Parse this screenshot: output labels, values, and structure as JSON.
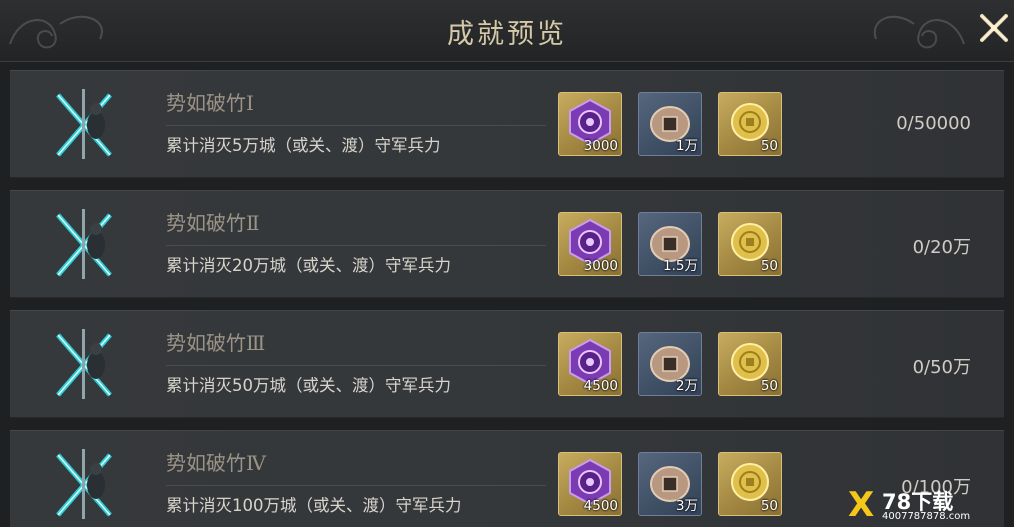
{
  "header": {
    "title": "成就预览"
  },
  "rows": [
    {
      "name": "势如破竹Ⅰ",
      "desc": "累计消灭5万城（或关、渡）守军兵力",
      "progress": "0/50000",
      "rewards": [
        {
          "icon": "purple-token-icon",
          "qty": "3000"
        },
        {
          "icon": "copper-coin-pouch-icon",
          "qty": "1万"
        },
        {
          "icon": "gold-coin-icon",
          "qty": "50"
        }
      ]
    },
    {
      "name": "势如破竹Ⅱ",
      "desc": "累计消灭20万城（或关、渡）守军兵力",
      "progress": "0/20万",
      "rewards": [
        {
          "icon": "purple-token-icon",
          "qty": "3000"
        },
        {
          "icon": "copper-coin-pouch-icon",
          "qty": "1.5万"
        },
        {
          "icon": "gold-coin-icon",
          "qty": "50"
        }
      ]
    },
    {
      "name": "势如破竹Ⅲ",
      "desc": "累计消灭50万城（或关、渡）守军兵力",
      "progress": "0/50万",
      "rewards": [
        {
          "icon": "purple-token-icon",
          "qty": "4500"
        },
        {
          "icon": "copper-coin-pouch-icon",
          "qty": "2万"
        },
        {
          "icon": "gold-coin-icon",
          "qty": "50"
        }
      ]
    },
    {
      "name": "势如破竹Ⅳ",
      "desc": "累计消灭100万城（或关、渡）守军兵力",
      "progress": "0/100万",
      "rewards": [
        {
          "icon": "purple-token-icon",
          "qty": "4500"
        },
        {
          "icon": "copper-coin-pouch-icon",
          "qty": "3万"
        },
        {
          "icon": "gold-coin-icon",
          "qty": "50"
        }
      ]
    }
  ],
  "watermark": {
    "logo": "X",
    "brand": "78下载",
    "url": "4007787878.com"
  },
  "colors": {
    "accent": "#d6c9a8",
    "teal_glow": "#2fe0e8"
  }
}
